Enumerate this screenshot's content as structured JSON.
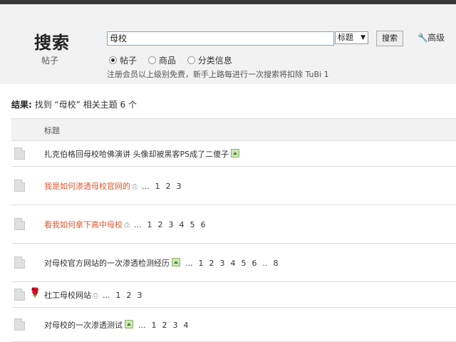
{
  "header": {
    "title": "搜索",
    "subtitle": "帖子",
    "search_value": "母校",
    "select_value": "标题",
    "search_button": "搜索",
    "advanced_label": "高级",
    "radios": [
      {
        "label": "帖子",
        "checked": true
      },
      {
        "label": "商品",
        "checked": false
      },
      {
        "label": "分类信息",
        "checked": false
      }
    ],
    "notice": "注册会员以上级别免费，新手上路每进行一次搜索将扣除 TuBi 1"
  },
  "result": {
    "prefix": "结果:",
    "text": "找到 “母校” 相关主题 6 个"
  },
  "table": {
    "column_title": "标题",
    "rows": [
      {
        "title": "扎克伯格回母校哈佛演讲 头像却被黑客PS成了二傻子",
        "color": "#333333",
        "attachment": false,
        "image": true,
        "flower": false,
        "ellipsis": "",
        "pages": []
      },
      {
        "title": "我是如何渗透母校官网的",
        "color": "#e4572e",
        "attachment": true,
        "image": false,
        "flower": false,
        "ellipsis": "...",
        "pages": [
          "1",
          "2",
          "3"
        ]
      },
      {
        "title": "看我如何拿下高中母校",
        "color": "#e4572e",
        "attachment": true,
        "image": false,
        "flower": false,
        "ellipsis": "...",
        "pages": [
          "1",
          "2",
          "3",
          "4",
          "5",
          "6"
        ]
      },
      {
        "title": "对母校官方网站的一次渗透检测经历",
        "color": "#333333",
        "attachment": false,
        "image": true,
        "flower": false,
        "ellipsis": "...",
        "pages": [
          "1",
          "2",
          "3",
          "4",
          "5",
          "6",
          "..",
          "8"
        ]
      },
      {
        "title": "社工母校网站",
        "color": "#333333",
        "attachment": true,
        "image": false,
        "flower": true,
        "ellipsis": "...",
        "pages": [
          "1",
          "2",
          "3"
        ]
      },
      {
        "title": "对母校的一次渗透测试",
        "color": "#333333",
        "attachment": false,
        "image": true,
        "flower": false,
        "ellipsis": "...",
        "pages": [
          "1",
          "2",
          "3",
          "4"
        ]
      }
    ]
  }
}
